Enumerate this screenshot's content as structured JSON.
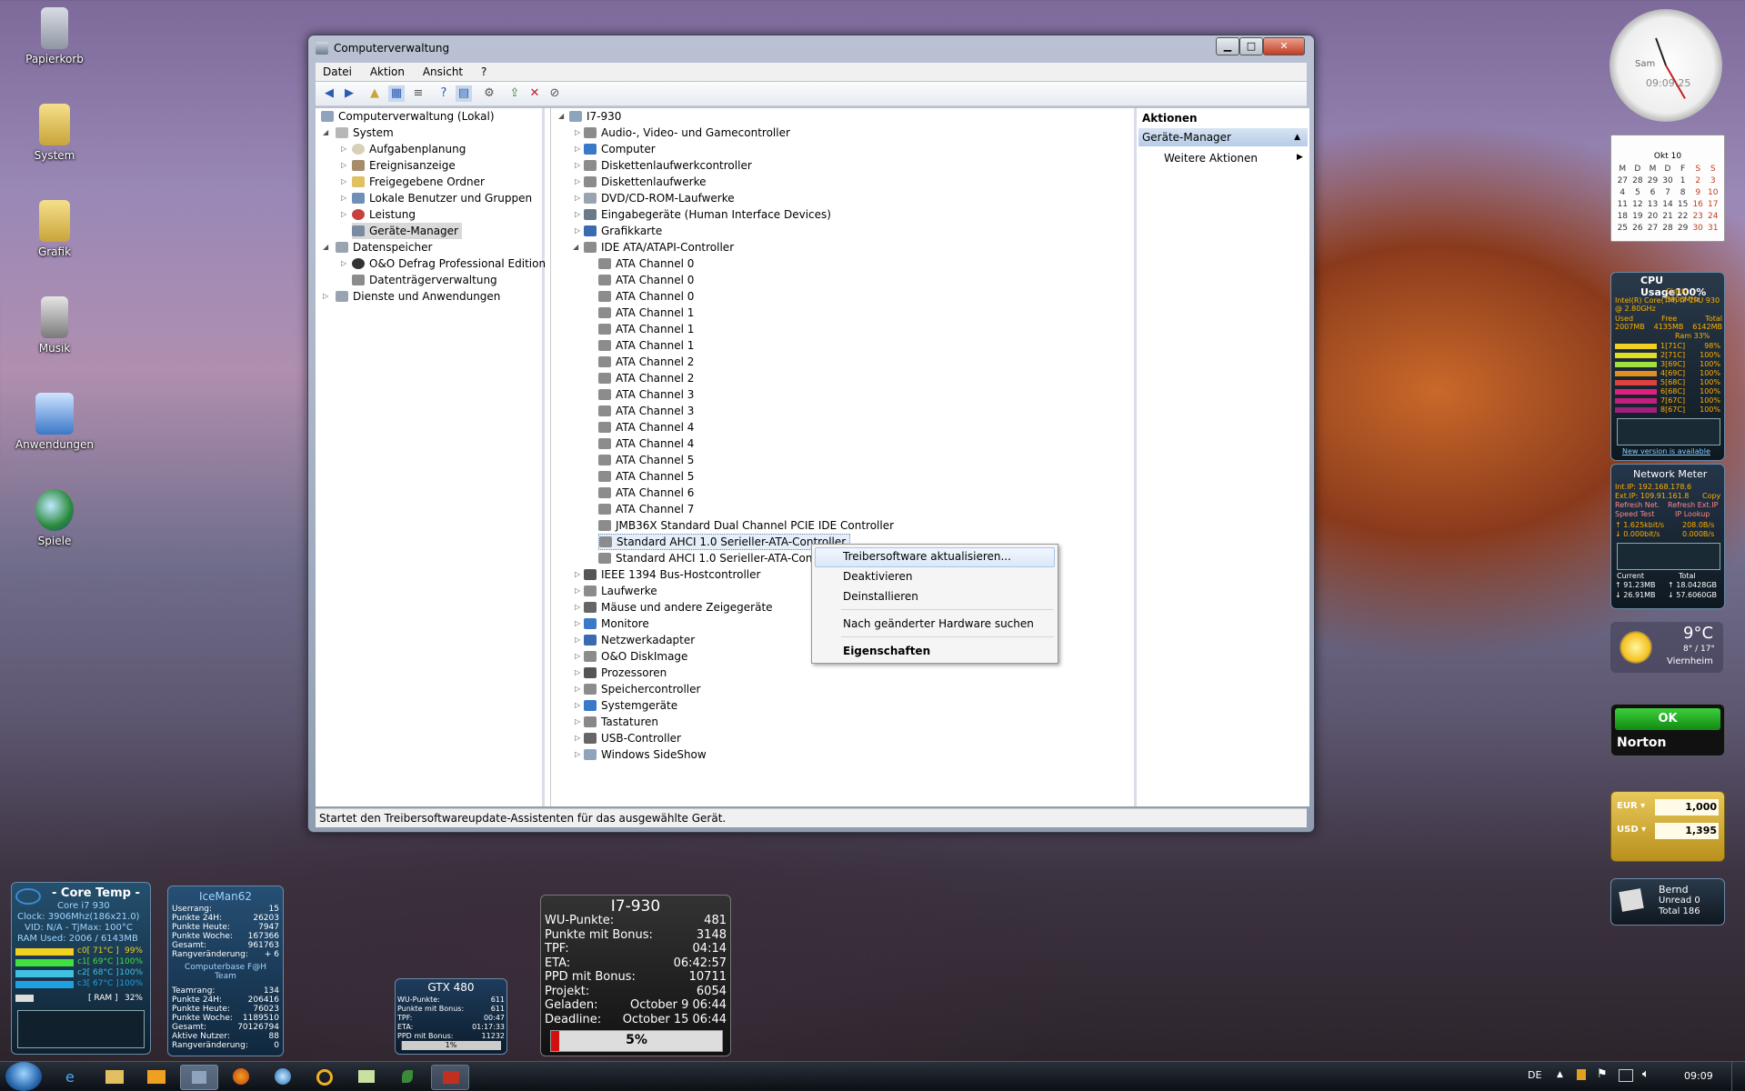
{
  "desktop": {
    "icons": [
      "Papierkorb",
      "System",
      "Grafik",
      "Musik",
      "Anwendungen",
      "Spiele"
    ]
  },
  "window": {
    "title": "Computerverwaltung",
    "menu": [
      "Datei",
      "Aktion",
      "Ansicht",
      "?"
    ],
    "tree": {
      "root": "Computerverwaltung (Lokal)",
      "system": "System",
      "system_items": [
        "Aufgabenplanung",
        "Ereignisanzeige",
        "Freigegebene Ordner",
        "Lokale Benutzer und Gruppen",
        "Leistung",
        "Geräte-Manager"
      ],
      "storage": "Datenspeicher",
      "storage_items": [
        "O&O Defrag Professional Edition",
        "Datenträgerverwaltung"
      ],
      "services": "Dienste und Anwendungen"
    },
    "devices": {
      "root": "I7-930",
      "categories_top": [
        "Audio-, Video- und Gamecontroller",
        "Computer",
        "Diskettenlaufwerkcontroller",
        "Diskettenlaufwerke",
        "DVD/CD-ROM-Laufwerke",
        "Eingabegeräte (Human Interface Devices)",
        "Grafikkarte"
      ],
      "ide": "IDE ATA/ATAPI-Controller",
      "ide_children": [
        "ATA Channel 0",
        "ATA Channel 0",
        "ATA Channel 0",
        "ATA Channel 1",
        "ATA Channel 1",
        "ATA Channel 1",
        "ATA Channel 2",
        "ATA Channel 2",
        "ATA Channel 3",
        "ATA Channel 3",
        "ATA Channel 4",
        "ATA Channel 4",
        "ATA Channel 5",
        "ATA Channel 5",
        "ATA Channel 6",
        "ATA Channel 7",
        "JMB36X Standard Dual Channel PCIE IDE Controller",
        "Standard AHCI 1.0 Serieller-ATA-Controller",
        "Standard AHCI 1.0 Serieller-ATA-Controller"
      ],
      "categories_bottom": [
        "IEEE 1394 Bus-Hostcontroller",
        "Laufwerke",
        "Mäuse und andere Zeigegeräte",
        "Monitore",
        "Netzwerkadapter",
        "O&O DiskImage",
        "Prozessoren",
        "Speichercontroller",
        "Systemgeräte",
        "Tastaturen",
        "USB-Controller",
        "Windows SideShow"
      ]
    },
    "actions": {
      "header": "Aktionen",
      "section": "Geräte-Manager",
      "more": "Weitere Aktionen"
    },
    "context_menu": [
      "Treibersoftware aktualisieren...",
      "Deaktivieren",
      "Deinstallieren",
      "Nach geänderter Hardware suchen",
      "Eigenschaften"
    ],
    "status": "Startet den Treibersoftwareupdate-Assistenten für das ausgewählte Gerät."
  },
  "gadgets": {
    "clock": {
      "time": "09:09:25",
      "label": "Sam"
    },
    "calendar": {
      "month": "Okt 10",
      "days_header": [
        "M",
        "D",
        "M",
        "D",
        "F",
        "S",
        "S"
      ],
      "weeks": [
        [
          "27",
          "28",
          "29",
          "30",
          "1",
          "2",
          "3"
        ],
        [
          "4",
          "5",
          "6",
          "7",
          "8",
          "9",
          "10"
        ],
        [
          "11",
          "12",
          "13",
          "14",
          "15",
          "16",
          "17"
        ],
        [
          "18",
          "19",
          "20",
          "21",
          "22",
          "23",
          "24"
        ],
        [
          "25",
          "26",
          "27",
          "28",
          "29",
          "30",
          "31"
        ]
      ]
    },
    "cpu": {
      "title": "CPU Usage100%",
      "clock": "Clock: 3906MHz",
      "model": "Intel(R) Core(TM) i7 CPU 930 @ 2.80GHz",
      "mem_labels": [
        "Used",
        "Free",
        "Total"
      ],
      "mem_values": [
        "2007MB",
        "4135MB",
        "6142MB"
      ],
      "ram": "Ram 33%",
      "cores": [
        [
          "1[71C]",
          "98%"
        ],
        [
          "2[71C]",
          "100%"
        ],
        [
          "3[69C]",
          "100%"
        ],
        [
          "4[69C]",
          "100%"
        ],
        [
          "5[68C]",
          "100%"
        ],
        [
          "6[68C]",
          "100%"
        ],
        [
          "7[67C]",
          "100%"
        ],
        [
          "8[67C]",
          "100%"
        ]
      ],
      "footer": "New version is available"
    },
    "network": {
      "title": "Network Meter",
      "int_ip": "Int.IP: 192.168.178.6",
      "ext_ip": "Ext.IP: 109.91.161.8",
      "copy": "Copy",
      "refresh_net": "Refresh Net.",
      "refresh_ext": "Refresh Ext.IP",
      "speed_test": "Speed Test",
      "ip_lookup": "IP Lookup",
      "up": "1.625kbit/s",
      "up2": "208.0B/s",
      "down": "0.000bit/s",
      "down2": "0.000B/s",
      "current": "Current",
      "total": "Total",
      "cur_up": "91.23MB",
      "cur_down": "26.91MB",
      "tot_up": "18.0428GB",
      "tot_down": "57.6060GB"
    },
    "weather": {
      "temp": "9°C",
      "range": "8° / 17°",
      "city": "Viernheim"
    },
    "norton": {
      "status": "OK",
      "brand": "Norton"
    },
    "currency": {
      "eur_label": "EUR",
      "eur_value": "1,000",
      "usd_label": "USD",
      "usd_value": "1,395"
    },
    "mail": {
      "user": "Bernd",
      "unread": "Unread 0",
      "total": "Total 186"
    },
    "coretemp": {
      "title": "- Core Temp -",
      "model": "Core i7 930",
      "clock": "Clock: 3906Mhz(186x21.0)",
      "vid": "VID: N/A - TjMax: 100°C",
      "ram_used": "RAM Used: 2006 / 6143MB",
      "cores": [
        [
          "c0[ 71°C ]",
          "99%"
        ],
        [
          "c1[ 69°C ]",
          "100%"
        ],
        [
          "c2[ 68°C ]",
          "100%"
        ],
        [
          "c3[ 67°C ]",
          "100%"
        ]
      ],
      "ram_row": [
        "[ RAM ]",
        "32%"
      ]
    },
    "iceman": {
      "title": "IceMan62",
      "rows": [
        [
          "Userrang:",
          "15"
        ],
        [
          "Punkte 24H:",
          "26203"
        ],
        [
          "Punkte Heute:",
          "7947"
        ],
        [
          "Punkte Woche:",
          "167366"
        ],
        [
          "Gesamt:",
          "961763"
        ],
        [
          "Rangveränderung:",
          "+ 6"
        ]
      ],
      "team": "Computerbase F@H Team",
      "team_rows": [
        [
          "Teamrang:",
          "134"
        ],
        [
          "Punkte 24H:",
          "206416"
        ],
        [
          "Punkte Heute:",
          "76023"
        ],
        [
          "Punkte Woche:",
          "1189510"
        ],
        [
          "Gesamt:",
          "70126794"
        ],
        [
          "Aktive Nutzer:",
          "88"
        ],
        [
          "Rangveränderung:",
          "0"
        ]
      ]
    },
    "fah_i7": {
      "title": "I7-930",
      "rows": [
        [
          "WU-Punkte:",
          "481"
        ],
        [
          "Punkte mit Bonus:",
          "3148"
        ],
        [
          "TPF:",
          "04:14"
        ],
        [
          "ETA:",
          "06:42:57"
        ],
        [
          "PPD mit Bonus:",
          "10711"
        ],
        [
          "Projekt:",
          "6054"
        ],
        [
          "Geladen:",
          "October 9 06:44"
        ],
        [
          "Deadline:",
          "October 15 06:44"
        ]
      ],
      "progress": "5%",
      "progress_value": 0.05
    },
    "fah_gtx": {
      "title": "GTX 480",
      "rows": [
        [
          "WU-Punkte:",
          "611"
        ],
        [
          "Punkte mit Bonus:",
          "611"
        ],
        [
          "TPF:",
          "00:47"
        ],
        [
          "ETA:",
          "01:17:33"
        ],
        [
          "PPD mit Bonus:",
          "11232"
        ]
      ],
      "progress": "1%"
    }
  },
  "taskbar": {
    "lang": "DE",
    "time": "09:09"
  }
}
